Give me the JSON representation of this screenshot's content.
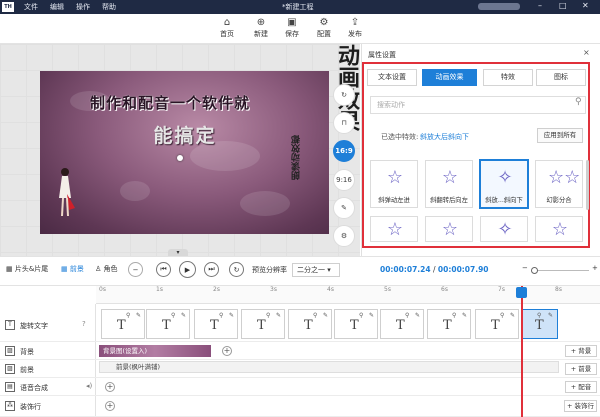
{
  "titlebar": {
    "logo": "TH",
    "menu": [
      "文件",
      "编辑",
      "操作",
      "帮助"
    ],
    "title": "*新建工程",
    "controls": [
      "–",
      "□",
      "✕"
    ]
  },
  "toolbar": [
    {
      "label": "首页",
      "icon": "home-icon",
      "glyph": "⌂"
    },
    {
      "label": "新建",
      "icon": "new-file-icon",
      "glyph": "⊕"
    },
    {
      "label": "保存",
      "icon": "save-icon",
      "glyph": "▣"
    },
    {
      "label": "配置",
      "icon": "settings-icon",
      "glyph": "⚙"
    },
    {
      "label": "发布",
      "icon": "publish-icon",
      "glyph": "⇪"
    }
  ],
  "stage": {
    "line1": "制作和配音一个软件就",
    "line2": "能搞定",
    "vertical_small": "朗读动效都",
    "vertical_large": "动画效果"
  },
  "side_tools": [
    {
      "icon": "rotate-icon",
      "glyph": "↻",
      "label": ""
    },
    {
      "icon": "lock-icon",
      "glyph": "⊓",
      "label": ""
    },
    {
      "icon": "ratio-16-9",
      "glyph": "",
      "label": "16:9",
      "active": true
    },
    {
      "icon": "ratio-9-16",
      "glyph": "",
      "label": "9:16"
    },
    {
      "icon": "edit-icon",
      "glyph": "✎",
      "label": ""
    },
    {
      "icon": "settings-icon",
      "glyph": "⚙",
      "label": ""
    }
  ],
  "props": {
    "title": "属性设置",
    "close": "×",
    "tabs": [
      "文本设置",
      "动画效果",
      "特效",
      "图标"
    ],
    "active_tab": 1,
    "search_placeholder": "搜索动作",
    "selected_label": "已选中特效:",
    "selected_value": "斜放大后斜向下",
    "apply_all": "应用到所有",
    "effects": [
      {
        "label": "斜弹动左进"
      },
      {
        "label": "斜翻转后向左"
      },
      {
        "label": "斜放...斜向下",
        "selected": true
      },
      {
        "label": "幻影分合"
      },
      {
        "label": ""
      },
      {
        "label": ""
      },
      {
        "label": ""
      },
      {
        "label": ""
      }
    ],
    "accent": "#1e7fd8",
    "highlight": "#e0303a"
  },
  "controls": {
    "film_label": "片头&片尾",
    "scene_label": "前景",
    "role_label": "角色",
    "resolution_label": "预览分辨率",
    "resolution_value": "二分之一",
    "time_current": "00:00:07.24",
    "time_sep": "/",
    "time_total": "00:00:07.90",
    "zoom_minus": "−",
    "zoom_plus": "+"
  },
  "ruler_ticks": [
    "0s",
    "1s",
    "2s",
    "3s",
    "4s",
    "5s",
    "6s",
    "7s",
    "8s"
  ],
  "tracks": [
    {
      "name": "旋转文字",
      "icon": "T"
    },
    {
      "name": "背景",
      "icon": "▨",
      "clip": "背景图(设置入)",
      "button": "+ 背景"
    },
    {
      "name": "前景",
      "icon": "▨",
      "clip": "前景(枫叶满铺)",
      "button": "+ 前景"
    },
    {
      "name": "语音合成",
      "icon": "▤",
      "button": "+ 配音"
    },
    {
      "name": "装饰行",
      "icon": "⁂",
      "button": "+ 装饰行"
    }
  ]
}
